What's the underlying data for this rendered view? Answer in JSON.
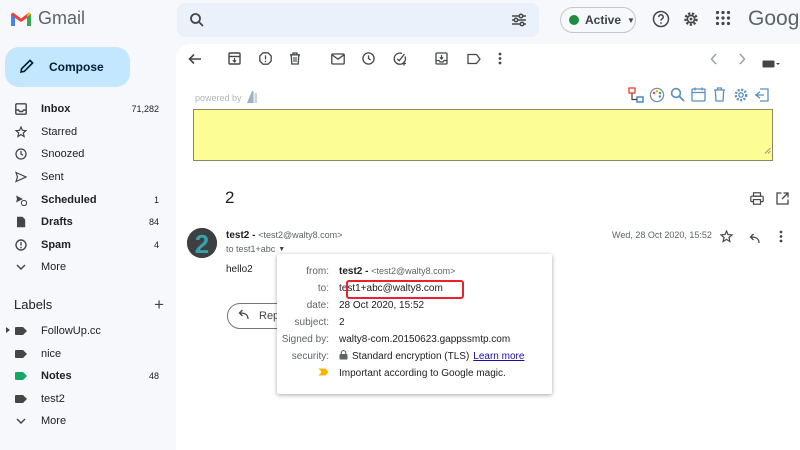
{
  "header": {
    "app_name": "Gmail",
    "status": "Active",
    "brand": "Google"
  },
  "sidebar": {
    "compose_label": "Compose",
    "items": [
      {
        "label": "Inbox",
        "count": "71,282",
        "bold": true,
        "icon": "inbox-icon"
      },
      {
        "label": "Starred",
        "count": "",
        "bold": false,
        "icon": "star-icon"
      },
      {
        "label": "Snoozed",
        "count": "",
        "bold": false,
        "icon": "clock-icon"
      },
      {
        "label": "Sent",
        "count": "",
        "bold": false,
        "icon": "send-icon"
      },
      {
        "label": "Scheduled",
        "count": "1",
        "bold": true,
        "icon": "scheduled-icon"
      },
      {
        "label": "Drafts",
        "count": "84",
        "bold": true,
        "icon": "draft-icon"
      },
      {
        "label": "Spam",
        "count": "4",
        "bold": true,
        "icon": "spam-icon"
      },
      {
        "label": "More",
        "count": "",
        "bold": false,
        "icon": "chevron-down-icon"
      }
    ],
    "labels_heading": "Labels",
    "labels": [
      {
        "label": "FollowUp.cc",
        "count": "",
        "color": "#444746",
        "caret": true,
        "bold": false
      },
      {
        "label": "nice",
        "count": "",
        "color": "#444746",
        "caret": false,
        "bold": false
      },
      {
        "label": "Notes",
        "count": "48",
        "color": "#16a765",
        "caret": false,
        "bold": true
      },
      {
        "label": "test2",
        "count": "",
        "color": "#444746",
        "caret": false,
        "bold": false
      },
      {
        "label": "More",
        "count": "",
        "color": "",
        "caret": false,
        "bold": false
      }
    ]
  },
  "main": {
    "powered_by": "powered by",
    "subject": "2",
    "sender_name": "test2 -",
    "sender_email": "<test2@walty8.com>",
    "to_line": "to test1+abc",
    "date": "Wed, 28 Oct 2020, 15:52",
    "body": "hello2",
    "reply_label": "Rep"
  },
  "details_popup": {
    "rows": [
      {
        "label": "from:",
        "value": "test2 -",
        "extra": "<test2@walty8.com>"
      },
      {
        "label": "to:",
        "value": "test1+abc@walty8.com",
        "extra": ""
      },
      {
        "label": "date:",
        "value": "28 Oct 2020, 15:52",
        "extra": ""
      },
      {
        "label": "subject:",
        "value": "2",
        "extra": ""
      },
      {
        "label": "Signed by:",
        "value": "walty8-com.20150623.gappssmtp.com",
        "extra": ""
      },
      {
        "label": "security:",
        "value": "Standard encryption (TLS)",
        "extra": "Learn more"
      },
      {
        "label": "",
        "value": "Important according to Google magic.",
        "extra": ""
      }
    ]
  },
  "colors": {
    "highlight": "#e8212a",
    "note_yellow": "#fdfd96",
    "compose_bg": "#c2e7ff"
  }
}
